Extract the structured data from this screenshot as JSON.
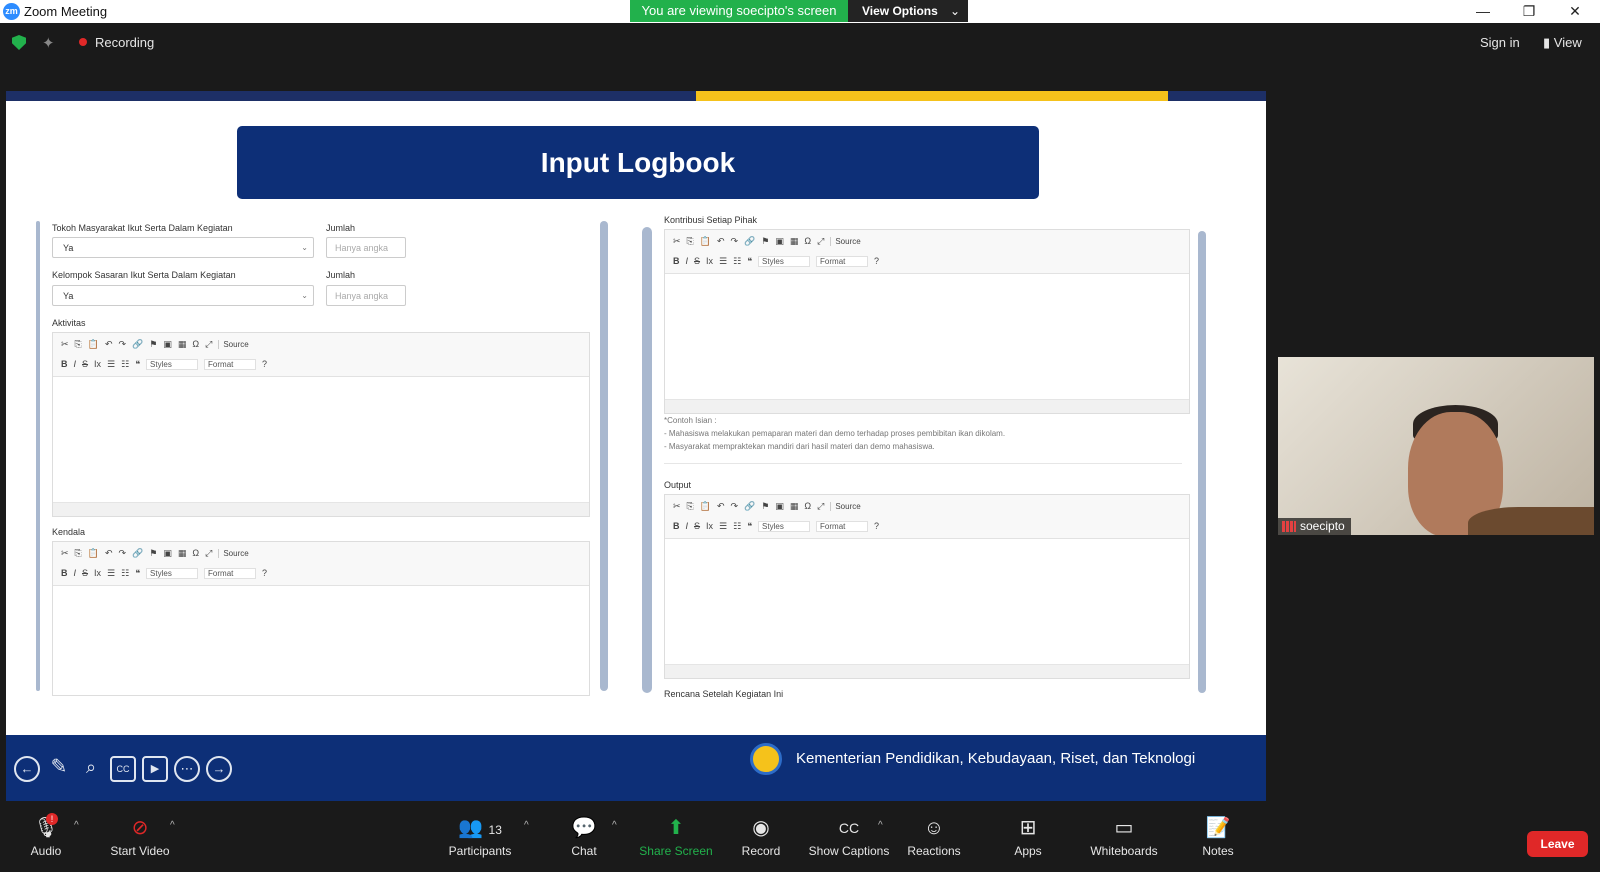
{
  "window": {
    "title": "Zoom Meeting",
    "viewing_banner": "You are viewing soecipto's screen",
    "view_options": "View Options",
    "minimize": "—",
    "restore": "❐",
    "close": "✕"
  },
  "meeting": {
    "recording": "Recording",
    "sign_in": "Sign in",
    "view": "View"
  },
  "slide": {
    "banner_title": "Input Logbook",
    "left": {
      "field1_label": "Tokoh Masyarakat Ikut Serta Dalam Kegiatan",
      "field1_value": "Ya",
      "jumlah1_label": "Jumlah",
      "jumlah1_placeholder": "Hanya angka",
      "field2_label": "Kelompok Sasaran Ikut Serta Dalam Kegiatan",
      "field2_value": "Ya",
      "jumlah2_label": "Jumlah",
      "jumlah2_placeholder": "Hanya angka",
      "aktivitas_label": "Aktivitas",
      "kendala_label": "Kendala"
    },
    "right": {
      "kontribusi_label": "Kontribusi Setiap Pihak",
      "hint_title": "*Contoh Isian :",
      "hint_line1": "- Mahasiswa melakukan pemaparan materi dan demo terhadap proses pembibitan ikan dikolam.",
      "hint_line2": "- Masyarakat mempraktekan mandiri dari hasil materi dan demo mahasiswa.",
      "output_label": "Output",
      "rencana_label": "Rencana Setelah Kegiatan Ini"
    },
    "editor_toolbar": {
      "source": "Source",
      "styles": "Styles",
      "format": "Format",
      "bold": "B",
      "italic": "I",
      "strike": "S",
      "help": "?"
    },
    "ministry": "Kementerian Pendidikan, Kebudayaan, Riset, dan Teknologi"
  },
  "video": {
    "name": "soecipto"
  },
  "toolbar": {
    "audio": "Audio",
    "start_video": "Start Video",
    "participants": "Participants",
    "participants_count": "13",
    "chat": "Chat",
    "share_screen": "Share Screen",
    "record": "Record",
    "show_captions": "Show Captions",
    "reactions": "Reactions",
    "apps": "Apps",
    "whiteboards": "Whiteboards",
    "notes": "Notes",
    "leave": "Leave"
  },
  "colors": {
    "share_green": "#22b14c",
    "leave_red": "#e02828",
    "slide_blue": "#0d2f77",
    "slide_yellow": "#f5c21b"
  }
}
